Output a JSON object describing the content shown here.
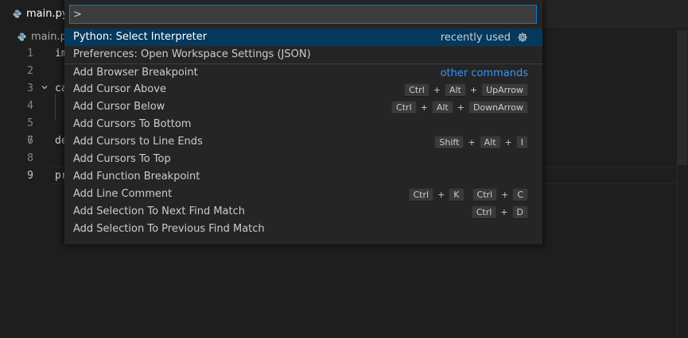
{
  "tab": {
    "filename": "main.py"
  },
  "breadcrumb": {
    "filename": "main.py"
  },
  "editor": {
    "lines": [
      {
        "num": "1",
        "code": "im"
      },
      {
        "num": "2",
        "code": ""
      },
      {
        "num": "3",
        "code": "ca"
      },
      {
        "num": "4",
        "code": ""
      },
      {
        "num": "5",
        "code": ""
      },
      {
        "num": "6",
        "code": ""
      },
      {
        "num": "7",
        "code": "de"
      },
      {
        "num": "8",
        "code": ""
      },
      {
        "num": "9",
        "code": "pr"
      }
    ]
  },
  "palette": {
    "input_value": ">",
    "items": [
      {
        "label": "Python: Select Interpreter",
        "hint": "recently used",
        "icon": "gear-icon"
      },
      {
        "label": "Preferences: Open Workspace Settings (JSON)"
      },
      {
        "label": "Add Browser Breakpoint",
        "hint": "other commands"
      },
      {
        "label": "Add Cursor Above",
        "keys": [
          "Ctrl",
          "Alt",
          "UpArrow"
        ]
      },
      {
        "label": "Add Cursor Below",
        "keys": [
          "Ctrl",
          "Alt",
          "DownArrow"
        ]
      },
      {
        "label": "Add Cursors To Bottom"
      },
      {
        "label": "Add Cursors to Line Ends",
        "keys": [
          "Shift",
          "Alt",
          "I"
        ]
      },
      {
        "label": "Add Cursors To Top"
      },
      {
        "label": "Add Function Breakpoint"
      },
      {
        "label": "Add Line Comment",
        "keys": [
          "Ctrl",
          "K"
        ],
        "keys2": [
          "Ctrl",
          "C"
        ]
      },
      {
        "label": "Add Selection To Next Find Match",
        "keys": [
          "Ctrl",
          "D"
        ]
      },
      {
        "label": "Add Selection To Previous Find Match"
      }
    ]
  },
  "colors": {
    "background": "#1e1e1e",
    "selection": "#04395e",
    "focus_border": "#007fd4",
    "link": "#3794ff"
  }
}
